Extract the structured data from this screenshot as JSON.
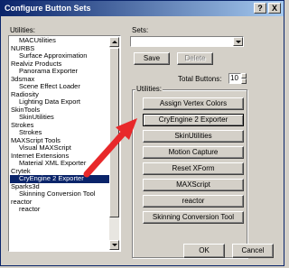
{
  "window": {
    "title": "Configure Button Sets",
    "help_label": "?",
    "close_label": "X"
  },
  "utilities": {
    "label": "Utilities:",
    "items": [
      {
        "text": "MACUtilities",
        "kind": "sub"
      },
      {
        "text": "NURBS",
        "kind": "top"
      },
      {
        "text": "Surface Approximation",
        "kind": "sub"
      },
      {
        "text": "Realviz Products",
        "kind": "top"
      },
      {
        "text": "Panorama Exporter",
        "kind": "sub"
      },
      {
        "text": "3dsmax",
        "kind": "top"
      },
      {
        "text": "Scene Effect Loader",
        "kind": "sub"
      },
      {
        "text": "Radiosity",
        "kind": "top"
      },
      {
        "text": "Lighting Data Export",
        "kind": "sub"
      },
      {
        "text": "SkinTools",
        "kind": "top"
      },
      {
        "text": "SkinUtilities",
        "kind": "sub"
      },
      {
        "text": "Strokes",
        "kind": "top"
      },
      {
        "text": "Strokes",
        "kind": "sub"
      },
      {
        "text": "MAXScript Tools",
        "kind": "top"
      },
      {
        "text": "Visual MAXScript",
        "kind": "sub"
      },
      {
        "text": "Internet Extensions",
        "kind": "top"
      },
      {
        "text": "Material XML Exporter",
        "kind": "sub"
      },
      {
        "text": "Crytek",
        "kind": "top"
      },
      {
        "text": "CryEngine 2 Exporter",
        "kind": "sub",
        "selected": true
      },
      {
        "text": "Sparks3d",
        "kind": "top"
      },
      {
        "text": "Skinning Conversion Tool",
        "kind": "sub"
      },
      {
        "text": "reactor",
        "kind": "top"
      },
      {
        "text": "reactor",
        "kind": "sub"
      }
    ]
  },
  "sets": {
    "label": "Sets:",
    "value": "",
    "save_label": "Save",
    "delete_label": "Delete"
  },
  "total": {
    "label": "Total Buttons:",
    "value": "10"
  },
  "utilities_group": {
    "label": "Utilities:",
    "buttons": [
      "Assign Vertex Colors",
      "CryEngine 2 Exporter",
      "SkinUtilities",
      "Motion Capture",
      "Reset XForm",
      "MAXScript",
      "reactor",
      "Skinning Conversion Tool"
    ],
    "highlighted_index": 1
  },
  "footer": {
    "ok_label": "OK",
    "cancel_label": "Cancel"
  },
  "colors": {
    "title_start": "#0a246a",
    "title_end": "#a6caf0",
    "selection": "#0a246a",
    "arrow": "#e8282a"
  }
}
